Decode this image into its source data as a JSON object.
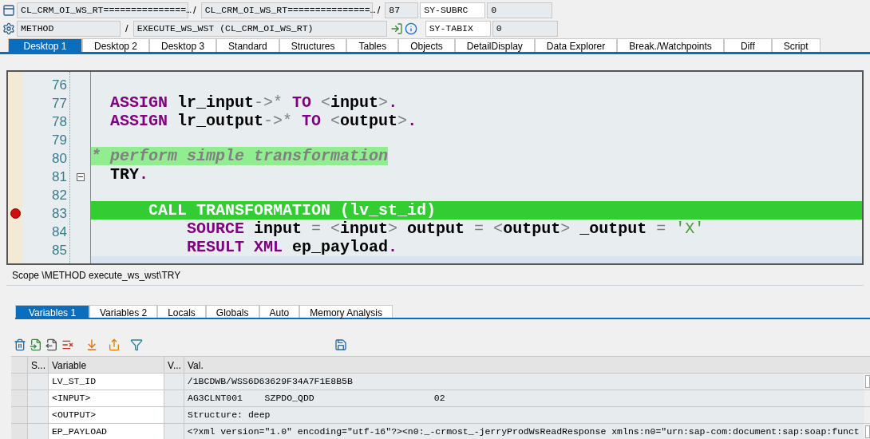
{
  "header": {
    "row_1": {
      "class_1": "CL_CRM_OI_WS_RT===============…",
      "separator_1": "/",
      "class_2": "CL_CRM_OI_WS_RT===============…",
      "separator_2": "/",
      "line": "87",
      "field_name": "SY-SUBRC",
      "field_value": "0"
    },
    "row_2": {
      "kind": "METHOD",
      "separator": "/",
      "name": "EXECUTE_WS_WST (CL_CRM_OI_WS_RT)",
      "field_name": "SY-TABIX",
      "field_value": "0"
    }
  },
  "desktop_tabs": [
    {
      "label": "Desktop 1",
      "selected": true
    },
    {
      "label": "Desktop 2",
      "selected": false
    },
    {
      "label": "Desktop 3",
      "selected": false
    },
    {
      "label": "Standard",
      "selected": false
    },
    {
      "label": "Structures",
      "selected": false
    },
    {
      "label": "Tables",
      "selected": false
    },
    {
      "label": "Objects",
      "selected": false
    },
    {
      "label": "DetailDisplay",
      "selected": false
    },
    {
      "label": "Data Explorer",
      "selected": false
    },
    {
      "label": "Break./Watchpoints",
      "selected": false
    },
    {
      "label": "Diff",
      "selected": false
    },
    {
      "label": "Script",
      "selected": false
    }
  ],
  "code": [
    {
      "number": "76",
      "current_line": false,
      "highlighted": false,
      "breakpoint": false,
      "fold": false
    },
    {
      "number": "77",
      "current_line": false,
      "highlighted": false,
      "breakpoint": false,
      "fold": false,
      "tokens": [
        {
          "kind": "keyword",
          "text": "  ASSIGN"
        },
        {
          "kind": "ident",
          "text": " lr_input"
        },
        {
          "kind": "op",
          "text": "->*"
        },
        {
          "kind": "keyword",
          "text": " TO"
        },
        {
          "kind": "op",
          "text": " <"
        },
        {
          "kind": "ident",
          "text": "input"
        },
        {
          "kind": "op",
          "text": ">"
        },
        {
          "kind": "keyword",
          "text": "."
        }
      ]
    },
    {
      "number": "78",
      "current_line": false,
      "highlighted": false,
      "breakpoint": false,
      "fold": false,
      "tokens": [
        {
          "kind": "keyword",
          "text": "  ASSIGN"
        },
        {
          "kind": "ident",
          "text": " lr_output"
        },
        {
          "kind": "op",
          "text": "->*"
        },
        {
          "kind": "keyword",
          "text": " TO"
        },
        {
          "kind": "op",
          "text": " <"
        },
        {
          "kind": "ident",
          "text": "output"
        },
        {
          "kind": "op",
          "text": ">"
        },
        {
          "kind": "keyword",
          "text": "."
        }
      ]
    },
    {
      "number": "79",
      "current_line": false,
      "highlighted": false,
      "breakpoint": false,
      "fold": false
    },
    {
      "number": "80",
      "current_line": false,
      "highlighted": true,
      "breakpoint": false,
      "fold": false,
      "tokens": [
        {
          "kind": "comment",
          "text": "* perform simple transformation"
        }
      ]
    },
    {
      "number": "81",
      "current_line": false,
      "highlighted": false,
      "breakpoint": false,
      "fold": true,
      "tokens": [
        {
          "kind": "ident",
          "text": "  TRY"
        },
        {
          "kind": "keyword",
          "text": "."
        }
      ]
    },
    {
      "number": "82",
      "current_line": false,
      "highlighted": false,
      "breakpoint": false,
      "fold": false
    },
    {
      "number": "83",
      "current_line": true,
      "highlighted": false,
      "breakpoint": true,
      "fold": false,
      "tokens": [
        {
          "kind": "keyword",
          "text": "      CALL TRANSFORMATION"
        },
        {
          "kind": "op",
          "text": " ("
        },
        {
          "kind": "ident",
          "text": "lv_st_id"
        },
        {
          "kind": "op",
          "text": ")"
        }
      ]
    },
    {
      "number": "84",
      "current_line": false,
      "highlighted": false,
      "breakpoint": false,
      "fold": false,
      "tokens": [
        {
          "kind": "keyword",
          "text": "          SOURCE"
        },
        {
          "kind": "ident",
          "text": " input"
        },
        {
          "kind": "op",
          "text": " = <"
        },
        {
          "kind": "ident",
          "text": "input"
        },
        {
          "kind": "op",
          "text": ">"
        },
        {
          "kind": "ident",
          "text": " output"
        },
        {
          "kind": "op",
          "text": " = <"
        },
        {
          "kind": "ident",
          "text": "output"
        },
        {
          "kind": "op",
          "text": ">"
        },
        {
          "kind": "ident",
          "text": " _output"
        },
        {
          "kind": "op",
          "text": " = "
        },
        {
          "kind": "string",
          "text": "'X'"
        }
      ]
    },
    {
      "number": "85",
      "current_line": false,
      "highlighted": false,
      "breakpoint": false,
      "fold": false,
      "tokens": [
        {
          "kind": "keyword",
          "text": "          RESULT XML"
        },
        {
          "kind": "ident",
          "text": " ep_payload"
        },
        {
          "kind": "keyword",
          "text": "."
        }
      ]
    }
  ],
  "scope": "Scope \\METHOD execute_ws_wst\\TRY",
  "variable_tabs": [
    {
      "label": "Variables 1",
      "selected": true
    },
    {
      "label": "Variables 2",
      "selected": false
    },
    {
      "label": "Locals",
      "selected": false
    },
    {
      "label": "Globals",
      "selected": false
    },
    {
      "label": "Auto",
      "selected": false
    },
    {
      "label": "Memory Analysis",
      "selected": false
    }
  ],
  "table": {
    "columns": [
      "S...",
      "Variable",
      "V...",
      "Val."
    ],
    "rows": [
      {
        "variable": "LV_ST_ID",
        "value": "/1BCDWB/WSS6D63629F34A7F1E8B5B",
        "detail_button": true
      },
      {
        "variable": "<INPUT>",
        "value": "AG3CLNT001    SZPDO_QDD",
        "extra": "02",
        "detail_button": false
      },
      {
        "variable": "<OUTPUT>",
        "value": "Structure: deep",
        "detail_button": false
      },
      {
        "variable": "EP_PAYLOAD",
        "value": "<?xml version=\"1.0\" encoding=\"utf-16\"?><n0:_-crmost_-jerryProdWsReadResponse xmlns:n0=\"urn:sap-com:document:sap:soap:funct",
        "detail_button": true
      }
    ]
  }
}
